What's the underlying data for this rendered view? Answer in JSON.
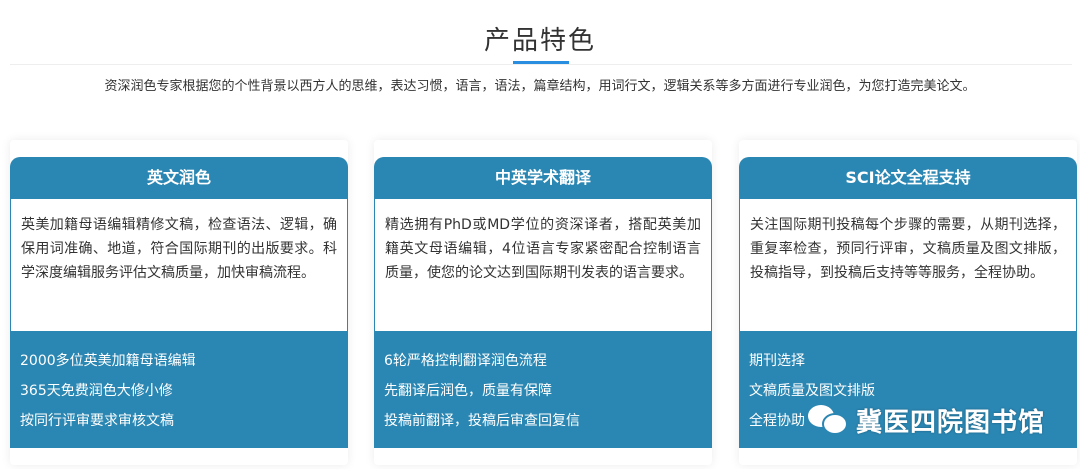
{
  "section": {
    "title": "产品特色",
    "subtitle": "资深润色专家根据您的个性背景以西方人的思维，表达习惯，语言，语法，篇章结构，用词行文，逻辑关系等多方面进行专业润色，为您打造完美论文。"
  },
  "cards": [
    {
      "title": "英文润色",
      "body": "英美加籍母语编辑精修文稿，检查语法、逻辑，确保用词准确、地道，符合国际期刊的出版要求。科学深度编辑服务评估文稿质量，加快审稿流程。",
      "features": [
        "2000多位英美加籍母语编辑",
        "365天免费润色大修小修",
        "按同行评审要求审核文稿"
      ]
    },
    {
      "title": "中英学术翻译",
      "body": "精选拥有PhD或MD学位的资深译者，搭配英美加籍英文母语编辑，4位语言专家紧密配合控制语言质量，使您的论文达到国际期刊发表的语言要求。",
      "features": [
        "6轮严格控制翻译润色流程",
        "先翻译后润色，质量有保障",
        "投稿前翻译，投稿后审查回复信"
      ]
    },
    {
      "title": "SCI论文全程支持",
      "body": "关注国际期刊投稿每个步骤的需要，从期刊选择，重复率检查，预同行评审，文稿质量及图文排版，投稿指导，到投稿后支持等等服务，全程协助。",
      "features": [
        "期刊选择",
        "文稿质量及图文排版",
        "全程协助"
      ]
    }
  ],
  "watermark": {
    "icon": "wechat-icon",
    "text": "冀医四院图书馆"
  },
  "colors": {
    "accent": "#2a86b2",
    "underline": "#2a8ee0"
  }
}
